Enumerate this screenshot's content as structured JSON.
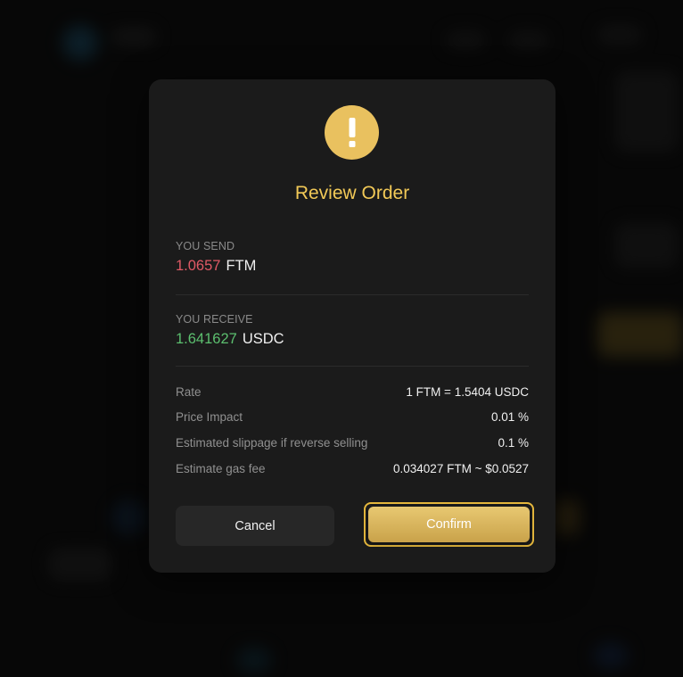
{
  "modal": {
    "title": "Review Order",
    "icon": "warning-exclamation-icon",
    "send": {
      "label": "YOU SEND",
      "amount": "1.0657",
      "token": "FTM"
    },
    "receive": {
      "label": "YOU RECEIVE",
      "amount": "1.641627",
      "token": "USDC"
    },
    "details": [
      {
        "label": "Rate",
        "value": "1 FTM = 1.5404 USDC"
      },
      {
        "label": "Price Impact",
        "value": "0.01 %"
      },
      {
        "label": "Estimated slippage if reverse selling",
        "value": "0.1 %"
      },
      {
        "label": "Estimate gas fee",
        "value": "0.034027 FTM ~ $0.0527"
      }
    ],
    "buttons": {
      "cancel": "Cancel",
      "confirm": "Confirm"
    }
  },
  "colors": {
    "accent": "#f2c957",
    "send": "#e05a66",
    "receive": "#5cbf6f",
    "modal_bg": "#1b1b1b"
  }
}
